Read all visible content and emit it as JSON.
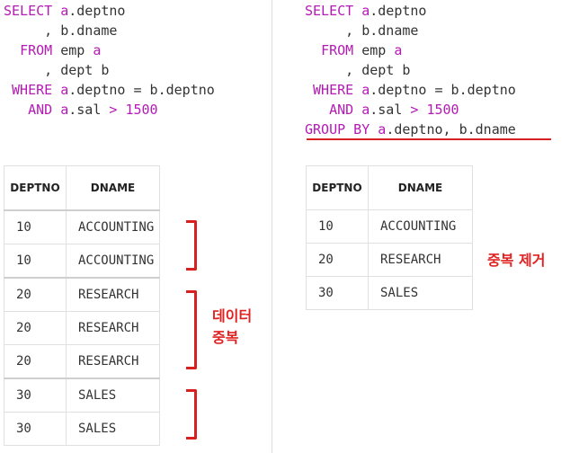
{
  "left_query": {
    "line1": {
      "kw": "SELECT",
      "alias": "a",
      "rest": ".deptno"
    },
    "line2": {
      "lead": ", ",
      "rest": "b.dname"
    },
    "line3": {
      "kw": "FROM",
      "rest": "emp",
      "alias": "a"
    },
    "line4": {
      "lead": ", ",
      "rest": "dept b"
    },
    "line5": {
      "kw": "WHERE",
      "alias": "a",
      "rest": ".deptno = b.deptno"
    },
    "line6": {
      "kw": "AND",
      "alias": "a",
      "rest": ".sal",
      "op": ">",
      "num": "1500"
    }
  },
  "right_query": {
    "line1": {
      "kw": "SELECT",
      "alias": "a",
      "rest": ".deptno"
    },
    "line2": {
      "lead": ", ",
      "rest": "b.dname"
    },
    "line3": {
      "kw": "FROM",
      "rest": "emp",
      "alias": "a"
    },
    "line4": {
      "lead": ", ",
      "rest": "dept b"
    },
    "line5": {
      "kw": "WHERE",
      "alias": "a",
      "rest": ".deptno = b.deptno"
    },
    "line6": {
      "kw": "AND",
      "alias": "a",
      "rest": ".sal",
      "op": ">",
      "num": "1500"
    },
    "line7": {
      "kw": "GROUP BY",
      "alias": "a",
      "rest": ".deptno, b.dname"
    }
  },
  "left_table": {
    "headers": [
      "DEPTNO",
      "DNAME"
    ],
    "rows": [
      [
        "10",
        "ACCOUNTING"
      ],
      [
        "10",
        "ACCOUNTING"
      ],
      [
        "20",
        "RESEARCH"
      ],
      [
        "20",
        "RESEARCH"
      ],
      [
        "20",
        "RESEARCH"
      ],
      [
        "30",
        "SALES"
      ],
      [
        "30",
        "SALES"
      ]
    ]
  },
  "right_table": {
    "headers": [
      "DEPTNO",
      "DNAME"
    ],
    "rows": [
      [
        "10",
        "ACCOUNTING"
      ],
      [
        "20",
        "RESEARCH"
      ],
      [
        "30",
        "SALES"
      ]
    ]
  },
  "annotations": {
    "duplicate_line1": "데이터",
    "duplicate_line2": "중복",
    "dedup": "중복 제거"
  },
  "colors": {
    "keyword": "#b41ab4",
    "annotation": "#e02222"
  }
}
